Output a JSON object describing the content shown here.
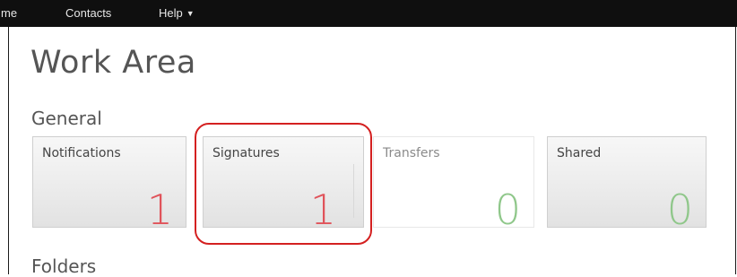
{
  "nav": {
    "items": [
      {
        "label": "me"
      },
      {
        "label": "Contacts"
      },
      {
        "label": "Help"
      }
    ]
  },
  "page": {
    "title": "Work Area",
    "sections": {
      "general": "General",
      "folders": "Folders"
    }
  },
  "tiles": [
    {
      "label": "Notifications",
      "count": "1",
      "count_color": "#e0535a"
    },
    {
      "label": "Signatures",
      "count": "1",
      "count_color": "#e0535a"
    },
    {
      "label": "Transfers",
      "count": "0",
      "count_color": "#8fc78a"
    },
    {
      "label": "Shared",
      "count": "0",
      "count_color": "#8fc78a"
    }
  ],
  "colors": {
    "navbar": "#0f0f0f",
    "highlight": "#d42020"
  },
  "icons": {
    "help_caret": "caret-down-icon"
  }
}
